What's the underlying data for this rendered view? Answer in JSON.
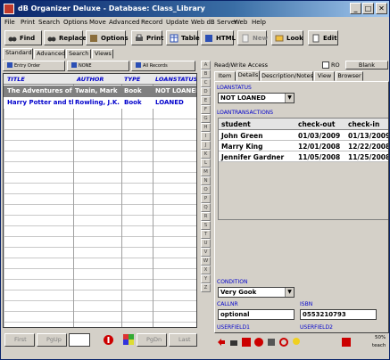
{
  "window": {
    "title": "dB Organizer Deluxe - Database: Class_Library",
    "min": "_",
    "max": "□",
    "close": "✕"
  },
  "menu": [
    "File",
    "Print",
    "Search",
    "Options",
    "Move",
    "Advanced",
    "Record",
    "Update",
    "Web dB Server",
    "Web",
    "Help"
  ],
  "toolbar": {
    "find": "Find",
    "replace": "Replace",
    "options": "Options",
    "print": "Print",
    "table": "Table",
    "html": "HTML",
    "new": "New",
    "lookup": "Look",
    "edit": "Edit"
  },
  "mode_tabs": [
    "Standard",
    "Advanced",
    "Search",
    "Views"
  ],
  "sort_buttons": [
    "Entry Order",
    "NONE",
    "All Records"
  ],
  "grid": {
    "headers": [
      "TITLE",
      "AUTHOR",
      "TYPE",
      "LOANSTATUS"
    ],
    "rows": [
      [
        "The Adventures of Huckleberry Finn",
        "Twain, Mark",
        "Book",
        "NOT LOANED"
      ],
      [
        "Harry Potter and the Sorcerer's Stone",
        "Rowling, J.K.",
        "Book",
        "LOANED"
      ]
    ]
  },
  "nav": {
    "first": "First",
    "pgup": "PgUp",
    "pgdn": "PgDn",
    "last": "Last"
  },
  "alphabet": [
    "A",
    "B",
    "C",
    "D",
    "E",
    "F",
    "G",
    "H",
    "I",
    "J",
    "K",
    "L",
    "M",
    "N",
    "O",
    "P",
    "Q",
    "R",
    "S",
    "T",
    "U",
    "V",
    "W",
    "X",
    "Y",
    "Z"
  ],
  "access": {
    "label": "Read/Write Access",
    "ro": "RO",
    "blank": "Blank"
  },
  "detail_tabs": [
    "Item",
    "Details",
    "Description/Notes",
    "View",
    "Browser"
  ],
  "loanstatus": {
    "label": "LOANSTATUS",
    "value": "NOT LOANED"
  },
  "loantransactions": {
    "label": "LOANTRANSACTIONS",
    "headers": [
      "student",
      "check-out",
      "check-in"
    ],
    "rows": [
      [
        "John Green",
        "01/03/2009",
        "01/13/2009"
      ],
      [
        "Marry King",
        "12/01/2008",
        "12/22/2008"
      ],
      [
        "Jennifer Gardner",
        "11/05/2008",
        "11/25/2008"
      ]
    ]
  },
  "condition": {
    "label": "CONDITION",
    "value": "Very Gook"
  },
  "callnr": {
    "label": "CALLNR",
    "value": "optional"
  },
  "isbn": {
    "label": "ISBN",
    "value": "0553210793"
  },
  "userfield1": {
    "label": "USERFIELD1"
  },
  "userfield2": {
    "label": "USERFIELD2"
  },
  "status": {
    "zoom": "50%",
    "user": "teach"
  },
  "colors": {
    "title_bar": "#0a246a",
    "link_blue": "#0000cc",
    "selected_row": "#808080"
  }
}
